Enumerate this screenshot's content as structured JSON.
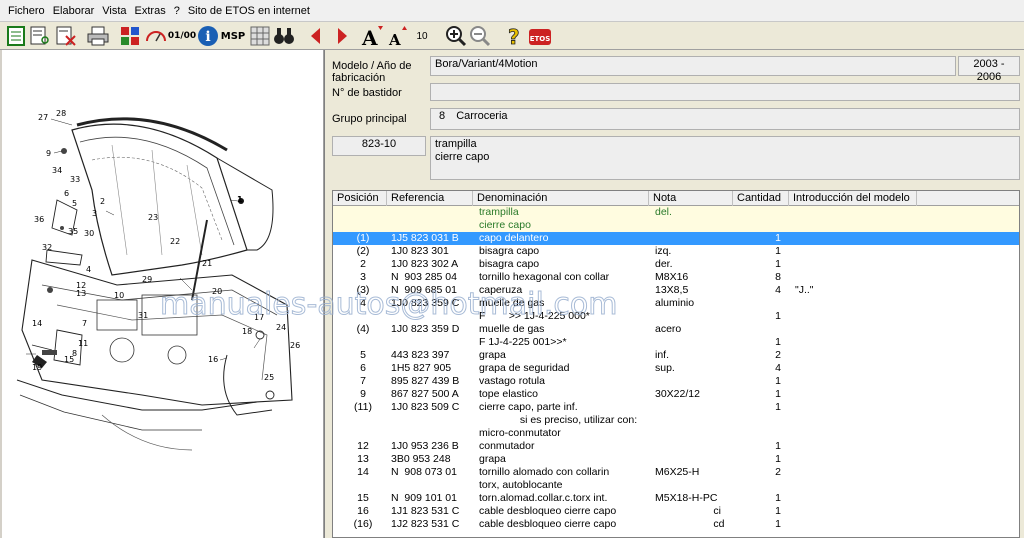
{
  "menu": [
    "Fichero",
    "Elaborar",
    "Vista",
    "Extras",
    "?",
    "Sito de ETOS  en internet"
  ],
  "toolbar": {
    "zoom_value": "10",
    "msp_label": "MSP",
    "ratio_label": "01/00",
    "etos_label": "ETOS"
  },
  "drawing": {
    "callouts": [
      "27",
      "28",
      "9",
      "34",
      "33",
      "2",
      "3",
      "36",
      "35",
      "32",
      "23",
      "22",
      "30",
      "1",
      "12",
      "13",
      "10",
      "29",
      "31",
      "14",
      "11",
      "17",
      "18",
      "24",
      "16",
      "26",
      "19",
      "15",
      "25",
      "8",
      "7",
      "6",
      "5",
      "4",
      "21",
      "20"
    ]
  },
  "info": {
    "model_label": "Modelo / Año de fabricación",
    "model_value": "Bora/Variant/4Motion",
    "years_value": "2003 - 2006",
    "vin_label": "N° de bastidor",
    "vin_value": "",
    "group_label": "Grupo principal",
    "group_number": "8",
    "group_name": "Carroceria",
    "subgroup_code": "823-10",
    "subgroup_line1": "trampilla",
    "subgroup_line2": "cierre capo"
  },
  "table": {
    "columns": [
      "Posición",
      "Referencia",
      "Denominación",
      "Nota",
      "Cantidad",
      "Introducción del modelo"
    ],
    "rows": [
      {
        "pos": "",
        "ref": "",
        "den": "trampilla",
        "nota": "del.",
        "cant": "",
        "intro": "",
        "kind": "header"
      },
      {
        "pos": "",
        "ref": "",
        "den": "cierre capo",
        "nota": "",
        "cant": "",
        "intro": "",
        "kind": "header"
      },
      {
        "pos": "(1)",
        "ref": "1J5 823 031 B",
        "den": "capo delantero",
        "nota": "",
        "cant": "1",
        "intro": "",
        "kind": "selected"
      },
      {
        "pos": "(2)",
        "ref": "1J0 823 301",
        "den": "bisagra capo",
        "nota": "izq.",
        "cant": "1",
        "intro": ""
      },
      {
        "pos": "2",
        "ref": "1J0 823 302 A",
        "den": "bisagra capo",
        "nota": "der.",
        "cant": "1",
        "intro": ""
      },
      {
        "pos": "3",
        "ref": "N  903 285 04",
        "den": "tornillo hexagonal con collar",
        "nota": "M8X16",
        "cant": "8",
        "intro": ""
      },
      {
        "pos": "(3)",
        "ref": "N  909 685 01",
        "den": "caperuza",
        "nota": "13X8,5",
        "cant": "4",
        "intro": "\"J..\""
      },
      {
        "pos": "4",
        "ref": "1J0 823 359 C",
        "den": "muelle de gas",
        "nota": "aluminio",
        "cant": "",
        "intro": ""
      },
      {
        "pos": "",
        "ref": "",
        "den": "F        >> 1J-4-225 000*",
        "nota": "",
        "cant": "1",
        "intro": ""
      },
      {
        "pos": "(4)",
        "ref": "1J0 823 359 D",
        "den": "muelle de gas",
        "nota": "acero",
        "cant": "",
        "intro": ""
      },
      {
        "pos": "",
        "ref": "",
        "den": "F 1J-4-225 001>>*",
        "nota": "",
        "cant": "1",
        "intro": ""
      },
      {
        "pos": "5",
        "ref": "443 823 397",
        "den": "grapa",
        "nota": "inf.",
        "cant": "2",
        "intro": ""
      },
      {
        "pos": "6",
        "ref": "1H5 827 905",
        "den": "grapa de seguridad",
        "nota": "sup.",
        "cant": "4",
        "intro": ""
      },
      {
        "pos": "7",
        "ref": "895 827 439 B",
        "den": "vastago rotula",
        "nota": "",
        "cant": "1",
        "intro": ""
      },
      {
        "pos": "9",
        "ref": "867 827 500 A",
        "den": "tope elastico",
        "nota": "30X22/12",
        "cant": "1",
        "intro": ""
      },
      {
        "pos": "(11)",
        "ref": "1J0 823 509 C",
        "den": "cierre capo, parte inf.",
        "nota": "",
        "cant": "1",
        "intro": ""
      },
      {
        "pos": "",
        "ref": "",
        "den": "              si es preciso, utilizar con:",
        "nota": "",
        "cant": "",
        "intro": ""
      },
      {
        "pos": "",
        "ref": "",
        "den": "micro-conmutator",
        "nota": "",
        "cant": "",
        "intro": ""
      },
      {
        "pos": "12",
        "ref": "1J0 953 236 B",
        "den": "conmutador",
        "nota": "",
        "cant": "1",
        "intro": ""
      },
      {
        "pos": "13",
        "ref": "3B0 953 248",
        "den": "grapa",
        "nota": "",
        "cant": "1",
        "intro": ""
      },
      {
        "pos": "14",
        "ref": "N  908 073 01",
        "den": "tornillo alomado con collarin",
        "nota": "M6X25-H",
        "cant": "2",
        "intro": ""
      },
      {
        "pos": "",
        "ref": "",
        "den": "torx, autoblocante",
        "nota": "",
        "cant": "",
        "intro": ""
      },
      {
        "pos": "15",
        "ref": "N  909 101 01",
        "den": "torn.alomad.collar.c.torx int.",
        "nota": "M5X18-H-PC",
        "cant": "1",
        "intro": ""
      },
      {
        "pos": "16",
        "ref": "1J1 823 531 C",
        "den": "cable desbloqueo cierre capo",
        "nota": "                    ci",
        "cant": "1",
        "intro": ""
      },
      {
        "pos": "(16)",
        "ref": "1J2 823 531 C",
        "den": "cable desbloqueo cierre capo",
        "nota": "                    cd",
        "cant": "1",
        "intro": ""
      }
    ]
  },
  "watermark": "manuales-autos@hotmail.com",
  "colors": {
    "selected": "#3399ff",
    "header_row_bg": "#fffce0",
    "header_row_text": "#2a7a2a",
    "toolbar_red": "#cc2222",
    "toolbar_blue": "#1a5fb4"
  }
}
